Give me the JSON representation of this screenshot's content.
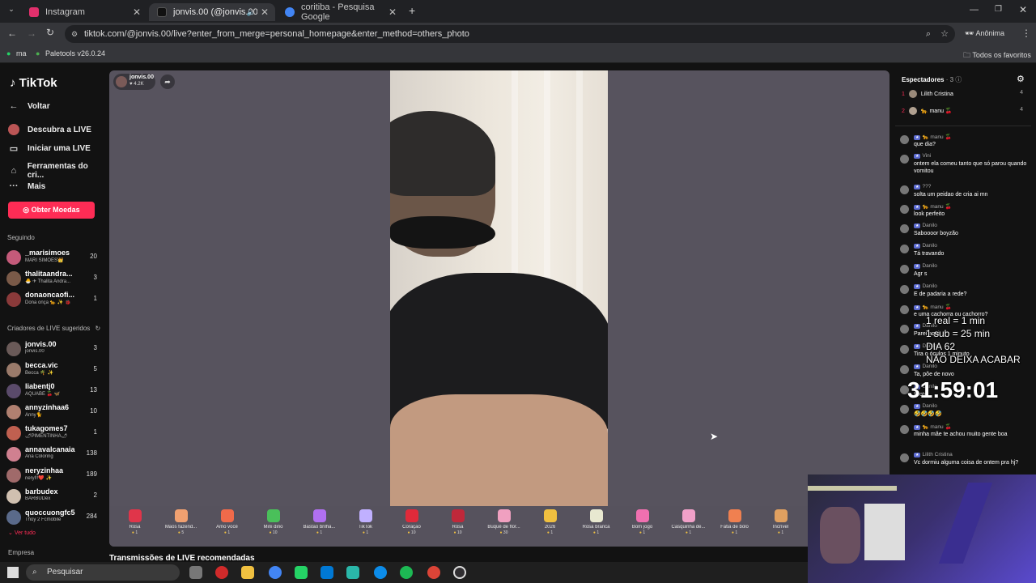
{
  "browser": {
    "tabs": [
      {
        "title": "Instagram",
        "favicon_color": "#e1306c"
      },
      {
        "title": "jonvis.00 (@jonvis.00) come",
        "favicon_color": "#000000"
      },
      {
        "title": "coritiba - Pesquisa Google",
        "favicon_color": "#4285f4"
      }
    ],
    "url": "tiktok.com/@jonvis.00/live?enter_from_merge=personal_homepage&enter_method=others_photo",
    "profile_label": "Anônima",
    "bookmarks": [
      "ma",
      "Paletools v26.0.24"
    ],
    "all_bookmarks": "Todos os favoritos"
  },
  "sidebar": {
    "brand": "TikTok",
    "back": "Voltar",
    "nav": [
      "Descubra a LIVE",
      "Iniciar uma LIVE",
      "Ferramentas do cri...",
      "Mais"
    ],
    "coins_button": "Obter Moedas",
    "following_title": "Seguindo",
    "following": [
      {
        "name": "_marisimoes",
        "sub": "MARI SIMÕES👑",
        "count": "20",
        "color": "#c45a7a"
      },
      {
        "name": "thalitaandra...",
        "sub": "🐣 ✈ Thalita Andra...",
        "count": "3",
        "color": "#7a5a48"
      },
      {
        "name": "donaoncaofi...",
        "sub": "Dona onça 🐆 ✨ 🐞",
        "count": "1",
        "color": "#8a3a3a"
      }
    ],
    "suggested_title": "Criadores de LIVE sugeridos",
    "suggested": [
      {
        "name": "jonvis.00",
        "sub": "jonvis.00",
        "count": "3",
        "color": "#6a5a58"
      },
      {
        "name": "becca.vic",
        "sub": "Becca 🌴 ✨",
        "count": "5",
        "color": "#9a7a6a"
      },
      {
        "name": "liabentj0",
        "sub": "AQUABE 🍒 🦋",
        "count": "13",
        "color": "#5a4a6a"
      },
      {
        "name": "annyzinhaa6",
        "sub": "Anny🐈",
        "count": "10",
        "color": "#b08070"
      },
      {
        "name": "tukagomes7",
        "sub": "🌶PIMENTINHA🌶",
        "count": "1",
        "color": "#c06050"
      },
      {
        "name": "annavalcanaia",
        "sub": "Ana Coloring",
        "count": "138",
        "color": "#d08090"
      },
      {
        "name": "neryzinhaa",
        "sub": "neryl!!❤️ ✨",
        "count": "189",
        "color": "#a06a6a"
      },
      {
        "name": "barbudex",
        "sub": "BARBUDex",
        "count": "2",
        "color": "#d0c0b0"
      },
      {
        "name": "quoccuongfc5",
        "sub": "Thủy 2 Fcmobile",
        "count": "284",
        "color": "#5a6a8a"
      }
    ],
    "see_all": "Ver tudo",
    "company": "Empresa"
  },
  "live": {
    "host_name": "jonvis.00",
    "host_likes": "4.2K",
    "recommended_title": "Transmissões de LIVE recomendadas"
  },
  "gifts": [
    {
      "name": "Rosa",
      "price": "1",
      "color": "#e0354a"
    },
    {
      "name": "Mãos fazend...",
      "price": "5",
      "color": "#f0a070"
    },
    {
      "name": "Amo você",
      "price": "1",
      "color": "#f06a4a"
    },
    {
      "name": "Mini dino",
      "price": "10",
      "color": "#4ac05a"
    },
    {
      "name": "Bastão brilha...",
      "price": "1",
      "color": "#b070f0"
    },
    {
      "name": "TikTok",
      "price": "1",
      "color": "#c0b0ff"
    },
    {
      "name": "Coração",
      "price": "10",
      "color": "#e02a3a"
    },
    {
      "name": "Rosa",
      "price": "10",
      "color": "#c0283a"
    },
    {
      "name": "Buquê de flor...",
      "price": "30",
      "color": "#f0a0c0"
    },
    {
      "name": "2026",
      "price": "1",
      "color": "#f0c040"
    },
    {
      "name": "Rosa branca",
      "price": "1",
      "color": "#e8e8d0"
    },
    {
      "name": "Bom jogo",
      "price": "1",
      "color": "#f070b0"
    },
    {
      "name": "Casquinha de...",
      "price": "1",
      "color": "#f0a0c8"
    },
    {
      "name": "Fatia de bolo",
      "price": "1",
      "color": "#f08050"
    },
    {
      "name": "Incrível",
      "price": "1",
      "color": "#e0a060"
    }
  ],
  "viewers": {
    "title": "Espectadores",
    "count": "3",
    "list": [
      {
        "rank": "1",
        "name": "Lilith Cristina",
        "score": "4"
      },
      {
        "rank": "2",
        "name": "🐆 manu 🍒",
        "score": "4"
      }
    ]
  },
  "chat": [
    {
      "who": "🐆 manu 🍒",
      "text": "que dia?"
    },
    {
      "who": "Vini",
      "text": "ontem ela comeu tanto que só parou quando vomitou"
    },
    {
      "who": "???",
      "text": "solta um peidao de cria ai mn"
    },
    {
      "who": "🐆 manu 🍒",
      "text": "look perfeito"
    },
    {
      "who": "Danilo",
      "text": "Saboooor boyzão"
    },
    {
      "who": "Danilo",
      "text": "Tá travando"
    },
    {
      "who": "Danilo",
      "text": "Agr s"
    },
    {
      "who": "Danilo",
      "text": "E de padaria a rede?"
    },
    {
      "who": "🐆 manu 🍒",
      "text": "e uma cachorra ou cachorro?"
    },
    {
      "who": "Danilo",
      "text": "Parei aqui"
    },
    {
      "who": "Danilo",
      "text": "Tira o óculos 1 minuto"
    },
    {
      "who": "Danilo",
      "text": "Ta, põe de novo"
    },
    {
      "who": "Danilo",
      "text": "Brotei"
    },
    {
      "who": "Danilo",
      "text": "🤣🤣🤣🤣"
    },
    {
      "who": "🐆 manu 🍒",
      "text": "minha mãe te achou muito gente boa"
    },
    {
      "who": "Lilith Cristina",
      "text": "Vc dormiu alguma coisa de ontem pra hj?"
    }
  ],
  "overlay": {
    "lines": [
      "1 real = 1 min",
      "1 sub = 25 min",
      "DIA 62",
      "NÃO DEIXA ACABAR"
    ],
    "timer": "31:59:01"
  },
  "taskbar": {
    "search_placeholder": "Pesquisar"
  }
}
